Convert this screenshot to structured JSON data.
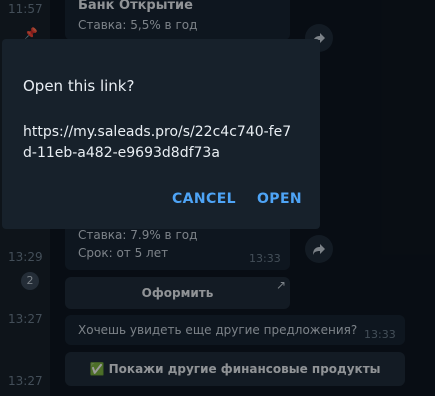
{
  "sidebar": {
    "times": [
      "11:57",
      "13:29",
      "13:27",
      "13:27"
    ],
    "unread_count": "2"
  },
  "messages": {
    "m1": {
      "title": "Банк Открытие",
      "line1": "Ставка: 5,5% в год"
    },
    "m2": {
      "line1": "Ставка: 7.9% в год",
      "line2": "Срок: от 5 лет",
      "time": "13:33"
    },
    "cta_button": "Оформить",
    "m3": {
      "text": "Хочешь увидеть еще другие предложения?",
      "time": "13:33"
    },
    "more_button": {
      "emoji": "✅",
      "label": "Покажи другие финансовые продукты"
    }
  },
  "dialog": {
    "title": "Open this link?",
    "url": "https://my.saleads.pro/s/22c4c740-fe7d-11eb-a482-e9693d8df73a",
    "cancel_label": "CANCEL",
    "open_label": "OPEN"
  },
  "colors": {
    "accent": "#4ea4f6",
    "background": "#0e1621",
    "dialog": "#17212b"
  }
}
